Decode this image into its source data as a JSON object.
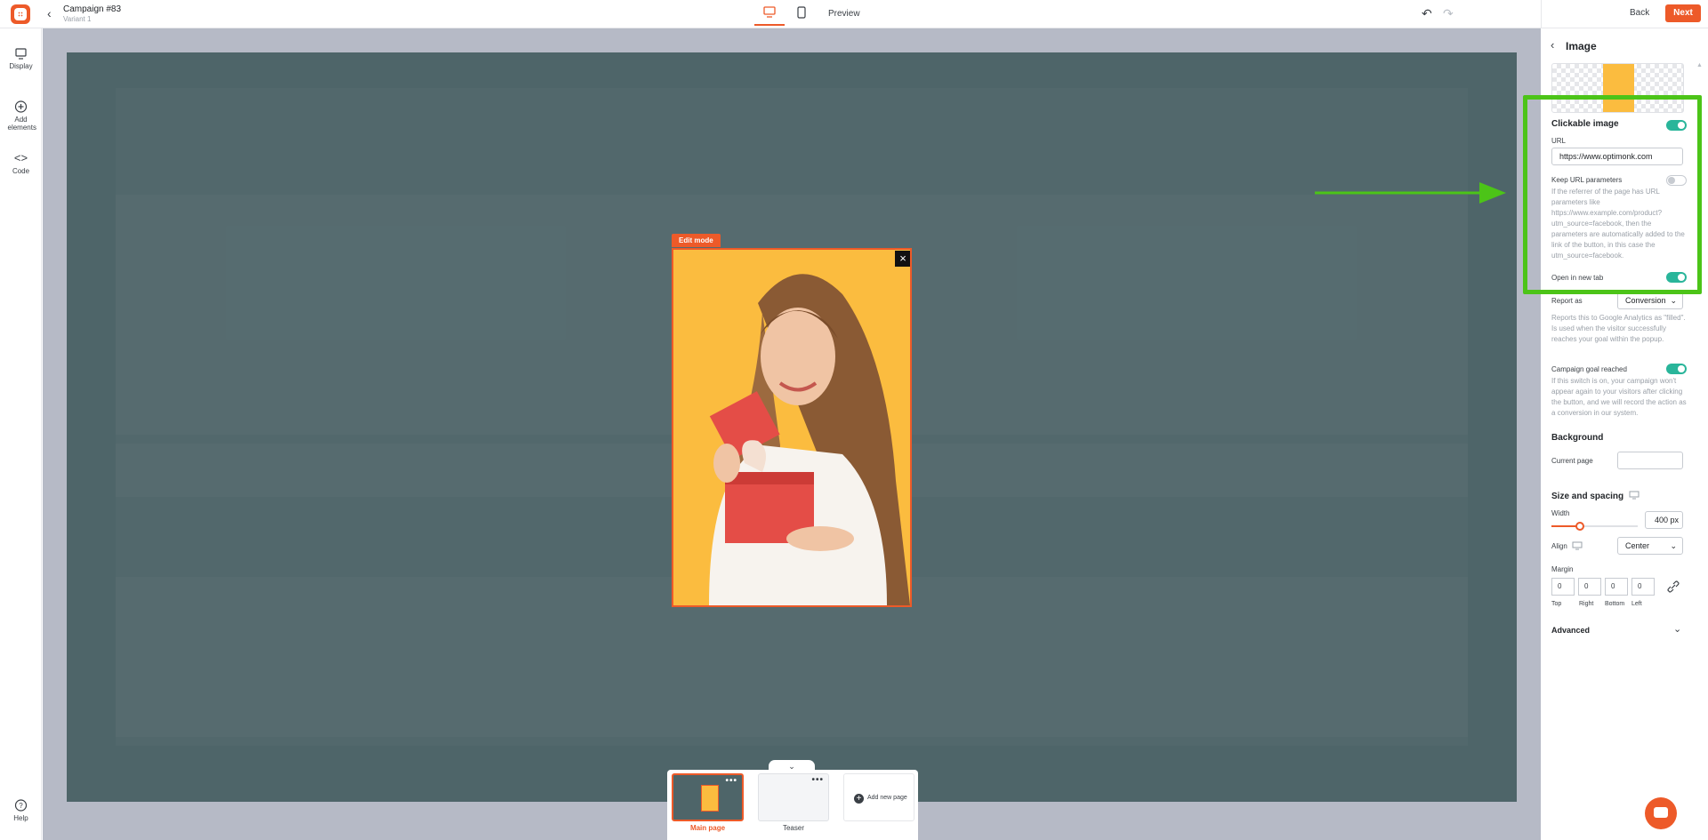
{
  "header": {
    "campaign_title": "Campaign #83",
    "variant": "Variant 1",
    "preview": "Preview",
    "back": "Back",
    "next": "Next"
  },
  "sidebar": {
    "items": [
      {
        "label": "Display",
        "icon": "monitor-icon"
      },
      {
        "label": "Add elements",
        "icon": "plus-circle-icon"
      },
      {
        "label": "Code",
        "icon": "code-icon"
      }
    ],
    "help": "Help"
  },
  "canvas": {
    "edit_badge": "Edit mode"
  },
  "pages": {
    "main_label": "Main page",
    "teaser_label": "Teaser",
    "add_page": "Add new page"
  },
  "panel": {
    "title": "Image",
    "clickable_image": "Clickable image",
    "url_label": "URL",
    "url_value": "https://www.optimonk.com",
    "keep_url_params": "Keep URL parameters",
    "keep_url_desc": "If the referrer of the page has URL parameters like https://www.example.com/product?utm_source=facebook, then the parameters are automatically added to the link of the button, in this case the utm_source=facebook.",
    "open_new_tab": "Open in new tab",
    "report_as": "Report as",
    "report_as_value": "Conversion",
    "report_desc": "Reports this to Google Analytics as \"filled\". Is used when the visitor successfully reaches your goal within the popup.",
    "goal_reached": "Campaign goal reached",
    "goal_desc": "If this switch is on, your campaign won't appear again to your visitors after clicking the button, and we will record the action as a conversion in our system.",
    "background": "Background",
    "current_page": "Current page",
    "size_spacing": "Size and spacing",
    "width_label": "Width",
    "width_value": "400 px",
    "width_fraction": 0.33,
    "align_label": "Align",
    "align_value": "Center",
    "margin_label": "Margin",
    "margins": [
      {
        "label": "Top",
        "value": "0"
      },
      {
        "label": "Right",
        "value": "0"
      },
      {
        "label": "Bottom",
        "value": "0"
      },
      {
        "label": "Left",
        "value": "0"
      }
    ],
    "advanced": "Advanced",
    "toggles": {
      "clickable_image": true,
      "keep_url_params": false,
      "open_new_tab": true,
      "goal_reached": true
    }
  },
  "colors": {
    "accent": "#ed5a29",
    "toggle_on": "#29b59a",
    "highlight": "#4cc418",
    "overlay": "#4e6569",
    "popup_bg": "#fbbc3f"
  }
}
